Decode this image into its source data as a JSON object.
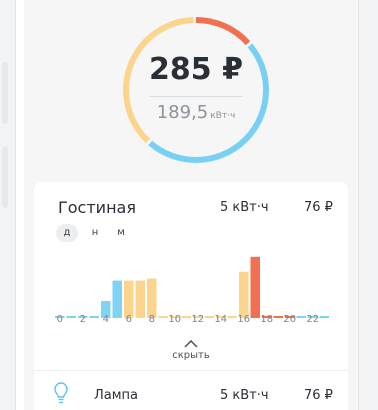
{
  "summary": {
    "total_cost": "285 ₽",
    "energy_value": "189,5",
    "energy_unit": "кВт·ч",
    "ring_segments": [
      {
        "name": "red",
        "fraction": 0.14,
        "color": "#f2704f"
      },
      {
        "name": "blue",
        "fraction": 0.48,
        "color": "#78d1f2"
      },
      {
        "name": "yellow",
        "fraction": 0.38,
        "color": "#fbd48e"
      }
    ]
  },
  "room": {
    "name": "Гостиная",
    "energy": "5 кВт·ч",
    "cost": "76 ₽",
    "periods": [
      "д",
      "н",
      "м"
    ],
    "hide_label": "скрыть"
  },
  "chart_data": {
    "type": "bar",
    "x": [
      0,
      1,
      2,
      3,
      4,
      5,
      6,
      7,
      8,
      9,
      10,
      11,
      12,
      13,
      14,
      15,
      16,
      17,
      18,
      19,
      20,
      21,
      22,
      23
    ],
    "x_ticks": [
      "0",
      "2",
      "4",
      "6",
      "8",
      "10",
      "12",
      "14",
      "16",
      "18",
      "20",
      "22"
    ],
    "values": [
      0.03,
      0.03,
      0.03,
      0.03,
      0.25,
      0.55,
      0.55,
      0.55,
      0.58,
      0.03,
      0.03,
      0.03,
      0.03,
      0.03,
      0.03,
      0.03,
      0.68,
      0.9,
      0.03,
      0.03,
      0.03,
      0.03,
      0.03,
      0.03
    ],
    "colors": [
      "#7fd3f3",
      "#7fd3f3",
      "#7fd3f3",
      "#7fd3f3",
      "#7fd3f3",
      "#7fd3f3",
      "#fbd48e",
      "#fbd48e",
      "#fbd48e",
      "#fbd48e",
      "#fbd48e",
      "#fbd48e",
      "#fbd48e",
      "#fbd48e",
      "#fbd48e",
      "#fbd48e",
      "#fbd48e",
      "#f2704f",
      "#f2704f",
      "#f2704f",
      "#f2704f",
      "#7fd3f3",
      "#7fd3f3",
      "#7fd3f3"
    ],
    "ylim": [
      0,
      1
    ],
    "grid": false
  },
  "device": {
    "name": "Лампа",
    "energy": "5 кВт·ч",
    "cost": "76 ₽",
    "icon": "lamp-icon"
  }
}
